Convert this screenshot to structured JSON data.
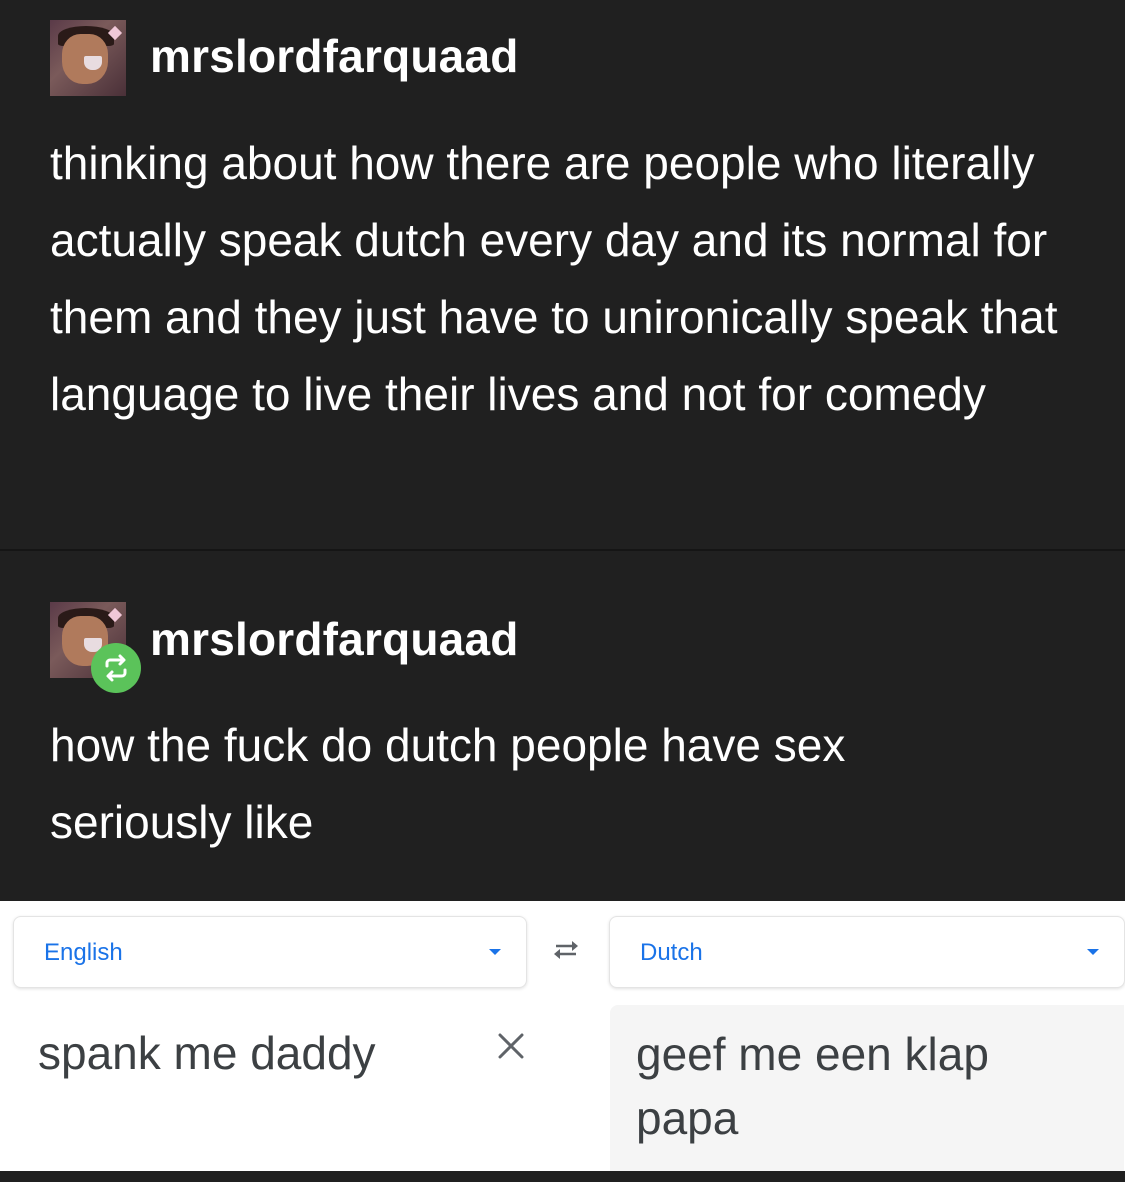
{
  "post1": {
    "username": "mrslordfarquaad",
    "text": "thinking about how there are people who literally actually speak dutch every day and its normal for them and they just have to unironically speak that language to live their lives and not for comedy"
  },
  "post2": {
    "username": "mrslordfarquaad",
    "text": "how the fuck do dutch people have sex seriously like"
  },
  "translator": {
    "source_language": "English",
    "target_language": "Dutch",
    "source_text": "spank me daddy",
    "translated_text": "geef me een klap papa"
  },
  "colors": {
    "background": "#202020",
    "reblog_green": "#5bc35a",
    "link_blue": "#1a73e8"
  },
  "icons": [
    "reblog-icon",
    "swap-languages-icon",
    "clear-icon",
    "dropdown-caret-icon"
  ]
}
